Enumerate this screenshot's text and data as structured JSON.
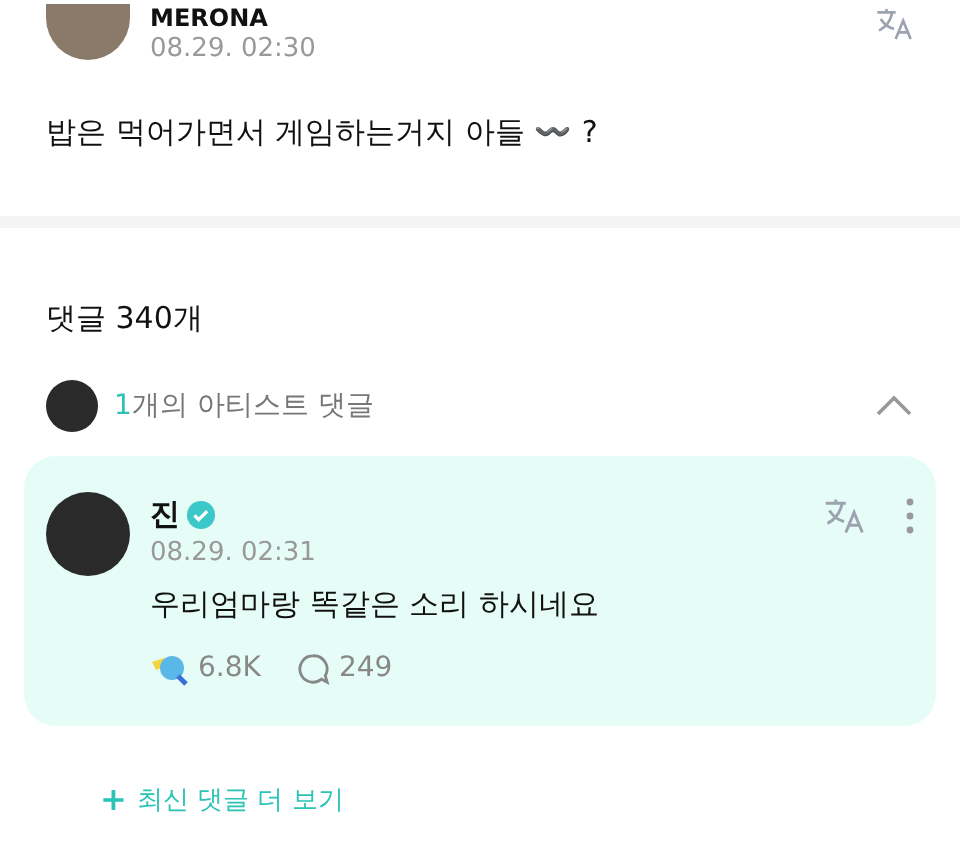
{
  "post": {
    "author": "MERONA",
    "time": "08.29. 02:30",
    "text": "밥은 먹어가면서 게임하는거지 아들 〰️ ?"
  },
  "comments_header": {
    "title": "댓글 340개"
  },
  "artist_comments": {
    "count": "1",
    "label": "개의 아티스트 댓글",
    "expanded": true,
    "items": [
      {
        "author": "진",
        "verified": true,
        "time": "08.29. 02:31",
        "text": "우리엄마랑 똑같은 소리 하시네요",
        "likes": "6.8K",
        "replies": "249"
      }
    ]
  },
  "more_button": {
    "icon": "+",
    "label": "최신 댓글 더 보기"
  }
}
